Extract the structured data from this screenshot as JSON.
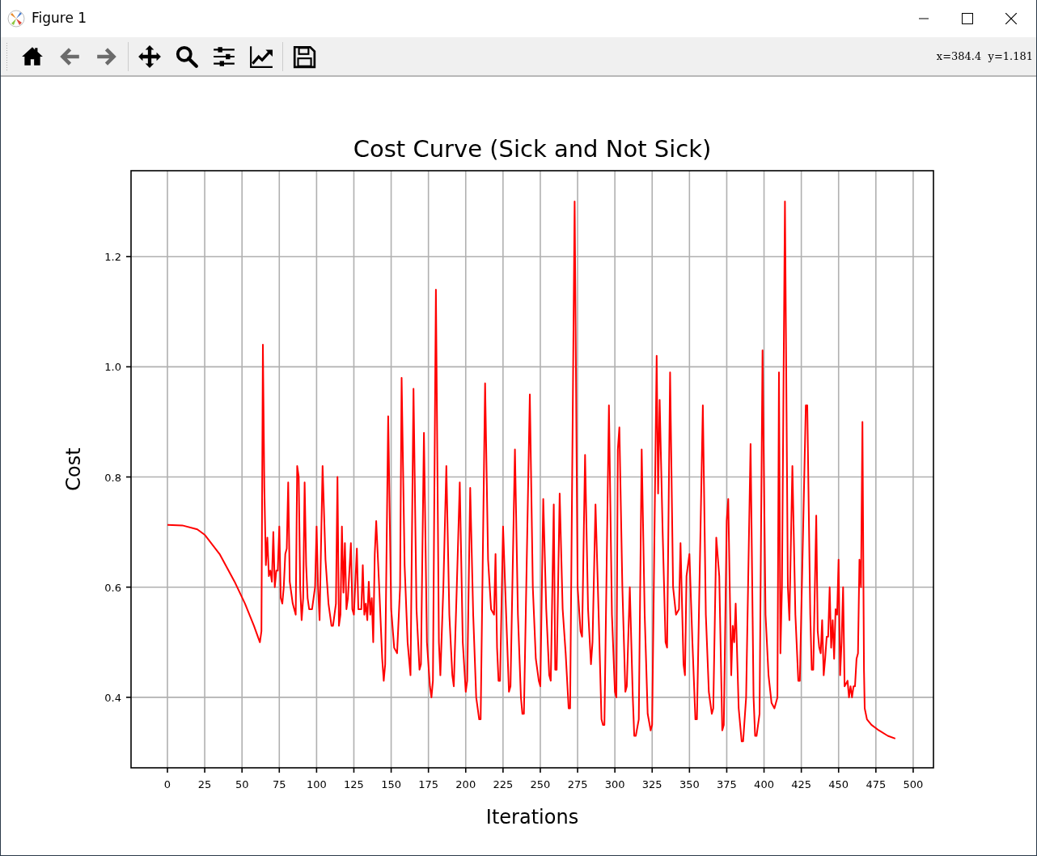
{
  "window": {
    "title": "Figure 1"
  },
  "toolbar": {
    "buttons": [
      {
        "kind": "home"
      },
      {
        "kind": "back"
      },
      {
        "kind": "forward"
      },
      {
        "kind": "separator"
      },
      {
        "kind": "pan"
      },
      {
        "kind": "zoom"
      },
      {
        "kind": "subplots"
      },
      {
        "kind": "axes"
      },
      {
        "kind": "separator"
      },
      {
        "kind": "save"
      }
    ],
    "coordinates": "x=384.4  y=1.181"
  },
  "figure": {
    "chart_data": {
      "type": "line",
      "grid": true,
      "title": "Cost Curve (Sick and Not Sick)",
      "xlabel": "Iterations",
      "ylabel": "Cost",
      "xlim": [
        -24.4,
        513.6
      ],
      "ylim": [
        0.272,
        1.356
      ],
      "xticks": [
        0,
        25,
        50,
        75,
        100,
        125,
        150,
        175,
        200,
        225,
        250,
        275,
        300,
        325,
        350,
        375,
        400,
        425,
        450,
        475,
        500
      ],
      "yticks": [
        {
          "value": 0.4,
          "label": "0.4"
        },
        {
          "value": 0.6,
          "label": "0.6"
        },
        {
          "value": 0.8,
          "label": "0.8"
        },
        {
          "value": 1.0,
          "label": "1.0"
        },
        {
          "value": 1.2,
          "label": "1.2"
        }
      ],
      "x": [
        0,
        10,
        20,
        25,
        35,
        45,
        52,
        58,
        62,
        63,
        64,
        65,
        66,
        67,
        68,
        69,
        70,
        71,
        72,
        73,
        74,
        75,
        76,
        77,
        78,
        79,
        80,
        81,
        82,
        84,
        86,
        87,
        88,
        89,
        90,
        91,
        92,
        93,
        94,
        95,
        97,
        99,
        100,
        101,
        102,
        104,
        106,
        108,
        110,
        111,
        113,
        114,
        115,
        116,
        117,
        118,
        119,
        120,
        121,
        123,
        124,
        125,
        127,
        128,
        130,
        131,
        132,
        133,
        134,
        135,
        136,
        137,
        138,
        139,
        140,
        142,
        144,
        145,
        146,
        148,
        150,
        152,
        154,
        156,
        157,
        159,
        161,
        163,
        165,
        167,
        169,
        170,
        172,
        174,
        176,
        177,
        178,
        180,
        182,
        183,
        185,
        187,
        189,
        191,
        192,
        194,
        196,
        198,
        200,
        201,
        203,
        205,
        207,
        209,
        210,
        213,
        215,
        217,
        219,
        220,
        221,
        222,
        223,
        225,
        227,
        229,
        230,
        233,
        235,
        237,
        238,
        239,
        243,
        245,
        247,
        249,
        250,
        252,
        254,
        256,
        257,
        259,
        260,
        261,
        263,
        265,
        267,
        269,
        270,
        273,
        275,
        277,
        278,
        280,
        282,
        284,
        285,
        287,
        289,
        291,
        292,
        293,
        296,
        298,
        300,
        301,
        302,
        303,
        305,
        307,
        308,
        310,
        312,
        313,
        314,
        316,
        318,
        320,
        322,
        324,
        325,
        328,
        329,
        330,
        332,
        334,
        335,
        337,
        339,
        341,
        343,
        344,
        346,
        347,
        348,
        350,
        352,
        354,
        355,
        359,
        361,
        363,
        365,
        366,
        368,
        370,
        372,
        373,
        375,
        376,
        378,
        379,
        380,
        381,
        383,
        385,
        386,
        388,
        391,
        393,
        394,
        395,
        397,
        399,
        401,
        403,
        405,
        407,
        409,
        410,
        411,
        412,
        414,
        416,
        417,
        419,
        421,
        423,
        424,
        428,
        429,
        431,
        432,
        433,
        435,
        436,
        437,
        438,
        439,
        440,
        441,
        442,
        443,
        444,
        445,
        446,
        447,
        448,
        449,
        450,
        451,
        452,
        453,
        454,
        456,
        457,
        458,
        459,
        460,
        461,
        462,
        463,
        464,
        465,
        466,
        467,
        467.5,
        469,
        472,
        477,
        483,
        488
      ],
      "series": [
        {
          "color": "#ff0000",
          "values": [
            0.713,
            0.712,
            0.705,
            0.695,
            0.66,
            0.61,
            0.57,
            0.53,
            0.5,
            0.52,
            1.04,
            0.78,
            0.64,
            0.69,
            0.62,
            0.63,
            0.61,
            0.7,
            0.6,
            0.63,
            0.63,
            0.71,
            0.58,
            0.57,
            0.6,
            0.66,
            0.67,
            0.79,
            0.61,
            0.57,
            0.55,
            0.82,
            0.8,
            0.6,
            0.54,
            0.58,
            0.79,
            0.64,
            0.58,
            0.56,
            0.56,
            0.6,
            0.71,
            0.6,
            0.54,
            0.82,
            0.65,
            0.57,
            0.53,
            0.53,
            0.57,
            0.8,
            0.53,
            0.55,
            0.71,
            0.59,
            0.68,
            0.56,
            0.58,
            0.68,
            0.56,
            0.55,
            0.67,
            0.56,
            0.56,
            0.64,
            0.55,
            0.57,
            0.54,
            0.61,
            0.55,
            0.58,
            0.5,
            0.66,
            0.72,
            0.6,
            0.47,
            0.43,
            0.46,
            0.91,
            0.56,
            0.49,
            0.48,
            0.6,
            0.98,
            0.64,
            0.5,
            0.44,
            0.96,
            0.56,
            0.45,
            0.46,
            0.88,
            0.5,
            0.42,
            0.4,
            0.43,
            1.14,
            0.5,
            0.44,
            0.6,
            0.82,
            0.55,
            0.44,
            0.42,
            0.6,
            0.79,
            0.5,
            0.41,
            0.43,
            0.78,
            0.55,
            0.4,
            0.36,
            0.36,
            0.97,
            0.65,
            0.56,
            0.55,
            0.66,
            0.49,
            0.43,
            0.43,
            0.71,
            0.56,
            0.41,
            0.42,
            0.85,
            0.55,
            0.4,
            0.37,
            0.37,
            0.95,
            0.6,
            0.47,
            0.43,
            0.42,
            0.76,
            0.56,
            0.44,
            0.43,
            0.75,
            0.45,
            0.45,
            0.77,
            0.56,
            0.48,
            0.38,
            0.38,
            1.3,
            0.6,
            0.52,
            0.51,
            0.84,
            0.56,
            0.46,
            0.5,
            0.75,
            0.56,
            0.36,
            0.35,
            0.35,
            0.93,
            0.55,
            0.41,
            0.4,
            0.85,
            0.89,
            0.6,
            0.41,
            0.42,
            0.6,
            0.4,
            0.33,
            0.33,
            0.36,
            0.85,
            0.55,
            0.37,
            0.34,
            0.35,
            1.02,
            0.77,
            0.94,
            0.7,
            0.5,
            0.49,
            0.99,
            0.6,
            0.55,
            0.56,
            0.68,
            0.46,
            0.44,
            0.62,
            0.66,
            0.5,
            0.36,
            0.36,
            0.93,
            0.55,
            0.41,
            0.37,
            0.38,
            0.69,
            0.62,
            0.34,
            0.35,
            0.72,
            0.76,
            0.44,
            0.53,
            0.5,
            0.57,
            0.38,
            0.32,
            0.32,
            0.4,
            0.86,
            0.4,
            0.33,
            0.33,
            0.37,
            1.03,
            0.55,
            0.44,
            0.39,
            0.38,
            0.4,
            0.99,
            0.48,
            0.6,
            1.3,
            0.6,
            0.54,
            0.82,
            0.55,
            0.43,
            0.43,
            0.93,
            0.93,
            0.55,
            0.45,
            0.45,
            0.73,
            0.52,
            0.49,
            0.48,
            0.54,
            0.44,
            0.47,
            0.51,
            0.51,
            0.6,
            0.49,
            0.54,
            0.47,
            0.56,
            0.55,
            0.65,
            0.44,
            0.5,
            0.6,
            0.42,
            0.43,
            0.4,
            0.42,
            0.4,
            0.42,
            0.42,
            0.47,
            0.48,
            0.65,
            0.6,
            0.9,
            0.45,
            0.38,
            0.36,
            0.35,
            0.34,
            0.33,
            0.325
          ]
        }
      ]
    }
  }
}
